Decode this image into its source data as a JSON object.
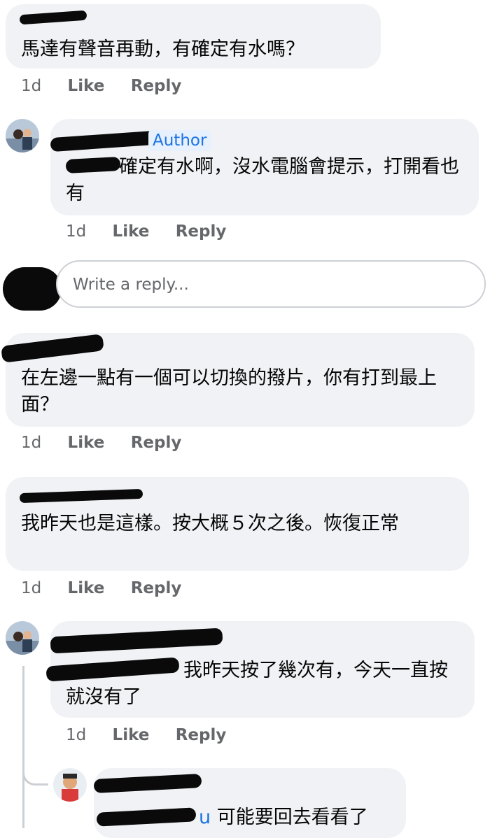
{
  "comments": [
    {
      "text": "馬達有聲音再動，有確定有水嗎？",
      "time": "1d",
      "like": "Like",
      "reply": "Reply"
    },
    {
      "author_badge": "Author",
      "text": "確定有水啊，沒水電腦會提示，打開看也有",
      "time": "1d",
      "like": "Like",
      "reply": "Reply"
    },
    {
      "text": "在左邊一點有一個可以切換的撥片，你有打到最上面？",
      "time": "1d",
      "like": "Like",
      "reply": "Reply"
    },
    {
      "text": "我昨天也是這樣。按大概５次之後。恢復正常",
      "time": "1d",
      "like": "Like",
      "reply": "Reply"
    },
    {
      "text": "我昨天按了幾次有，今天一直按就沒有了",
      "time": "1d",
      "like": "Like",
      "reply": "Reply"
    },
    {
      "mention_suffix": "u",
      "text": "可能要回去看看了"
    }
  ],
  "reply_box": {
    "placeholder": "Write a reply..."
  }
}
